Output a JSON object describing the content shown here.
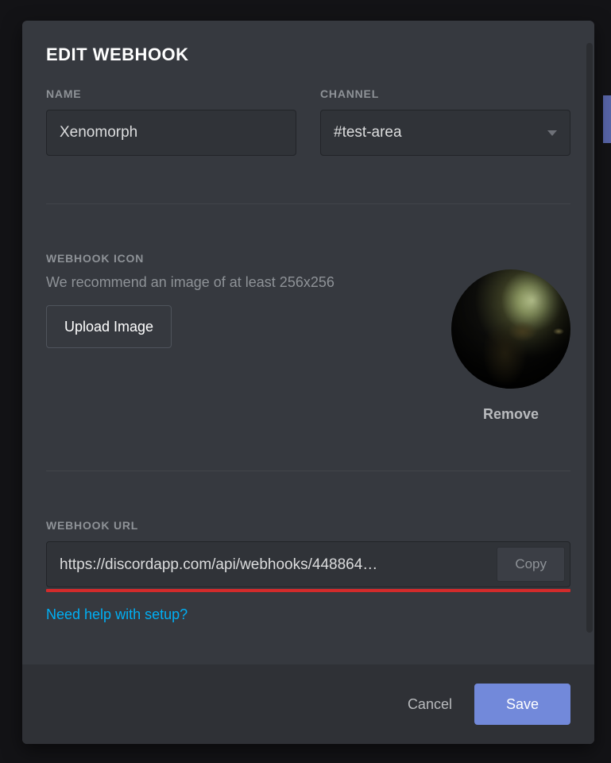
{
  "modal": {
    "title": "EDIT WEBHOOK",
    "name_label": "NAME",
    "name_value": "Xenomorph",
    "channel_label": "CHANNEL",
    "channel_value": "#test-area",
    "icon_label": "WEBHOOK ICON",
    "icon_hint": "We recommend an image of at least 256x256",
    "upload_label": "Upload Image",
    "remove_label": "Remove",
    "url_label": "WEBHOOK URL",
    "url_value": "https://discordapp.com/api/webhooks/448864…",
    "copy_label": "Copy",
    "help_link": "Need help with setup?",
    "cancel_label": "Cancel",
    "save_label": "Save"
  },
  "colors": {
    "accent": "#7289da",
    "link": "#00aff4",
    "annotation": "#d22b2b"
  }
}
